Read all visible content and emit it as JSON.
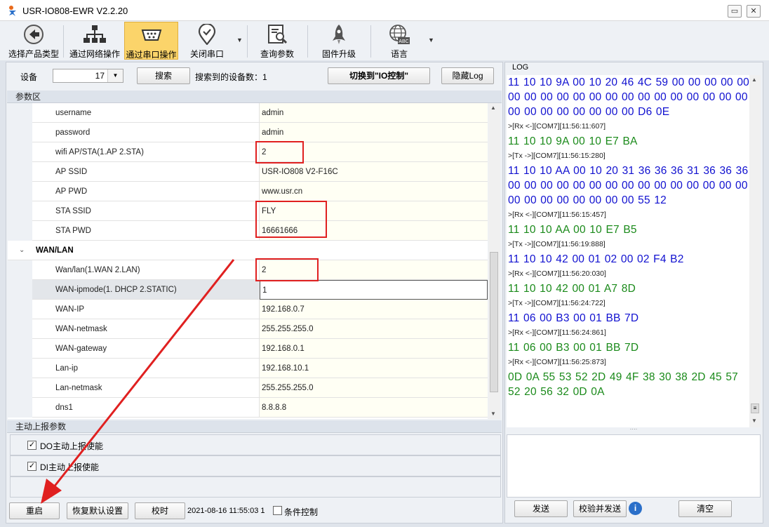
{
  "window": {
    "title": "USR-IO808-EWR V2.2.20",
    "minimize": "▭",
    "close": "✕"
  },
  "toolbar": {
    "items": [
      {
        "label": "选择产品类型",
        "icon": "back-arrow-icon"
      },
      {
        "label": "通过网络操作",
        "icon": "network-icon"
      },
      {
        "label": "通过串口操作",
        "icon": "serial-port-icon"
      },
      {
        "label": "关闭串口",
        "icon": "map-pin-icon"
      },
      {
        "label": "查询参数",
        "icon": "search-document-icon"
      },
      {
        "label": "固件升级",
        "icon": "rocket-icon"
      },
      {
        "label": "语言",
        "icon": "globe-abc-icon"
      }
    ],
    "dropdown_glyph": "▼"
  },
  "device_bar": {
    "device_label": "设备",
    "device_value": "17",
    "search_button": "搜索",
    "found_text": "搜索到的设备数：1",
    "switch_button": "切换到\"IO控制\"",
    "hide_log_button": "隐藏Log"
  },
  "params": {
    "header": "参数区",
    "rows": [
      {
        "name": "username",
        "value": "admin"
      },
      {
        "name": "password",
        "value": "admin"
      },
      {
        "name": "wifi AP/STA(1.AP 2.STA)",
        "value": "2"
      },
      {
        "name": "AP SSID",
        "value": "USR-IO808 V2-F16C"
      },
      {
        "name": "AP PWD",
        "value": "www.usr.cn"
      },
      {
        "name": "STA SSID",
        "value": "FLY"
      },
      {
        "name": "STA PWD",
        "value": "16661666"
      }
    ],
    "category": "WAN/LAN",
    "category_rows": [
      {
        "name": "Wan/lan(1.WAN 2.LAN)",
        "value": "2"
      },
      {
        "name": "WAN-ipmode(1. DHCP 2.STATIC)",
        "value": "1"
      },
      {
        "name": "WAN-IP",
        "value": "192.168.0.7"
      },
      {
        "name": "WAN-netmask",
        "value": "255.255.255.0"
      },
      {
        "name": "WAN-gateway",
        "value": "192.168.0.1"
      },
      {
        "name": "Lan-ip",
        "value": "192.168.10.1"
      },
      {
        "name": "Lan-netmask",
        "value": "255.255.255.0"
      },
      {
        "name": "dns1",
        "value": "8.8.8.8"
      }
    ]
  },
  "auto_report": {
    "header": "主动上报参数",
    "options": [
      {
        "label": "DO主动上报使能",
        "checked": true
      },
      {
        "label": "DI主动上报使能",
        "checked": true
      }
    ]
  },
  "bottom_bar": {
    "restart_button": "重启",
    "restore_button": "恢复默认设置",
    "time_button": "校时",
    "timestamp": "2021-08-16 11:55:03 1",
    "condition_label": "条件控制"
  },
  "log": {
    "header": "LOG",
    "lines": [
      {
        "kind": "rx",
        "text": "11 10 10 9A 00 10 20 46 4C 59 00 00 00 00 00 00 00 00 00 00 00 00 00 00 00 00 00 00 00 00 00 00 00 00 00 00 00 00 D6 0E"
      },
      {
        "kind": "meta",
        "text": ">[Rx <-][COM7][11:56:11:607]"
      },
      {
        "kind": "tx",
        "text": "11 10 10 9A 00 10 E7 BA"
      },
      {
        "kind": "meta",
        "text": ">[Tx ->][COM7][11:56:15:280]"
      },
      {
        "kind": "rx",
        "text": "11 10 10 AA 00 10 20 31 36 36 36 31 36 36 36 00 00 00 00 00 00 00 00 00 00 00 00 00 00 00 00 00 00 00 00 00 00 00 55 12"
      },
      {
        "kind": "meta",
        "text": ">[Rx <-][COM7][11:56:15:457]"
      },
      {
        "kind": "tx",
        "text": "11 10 10 AA 00 10 E7 B5"
      },
      {
        "kind": "meta",
        "text": ">[Tx ->][COM7][11:56:19:888]"
      },
      {
        "kind": "rx",
        "text": "11 10 10 42 00 01 02 00 02 F4 B2"
      },
      {
        "kind": "meta",
        "text": ">[Rx <-][COM7][11:56:20:030]"
      },
      {
        "kind": "tx",
        "text": "11 10 10 42 00 01 A7 8D"
      },
      {
        "kind": "meta",
        "text": ">[Tx ->][COM7][11:56:24:722]"
      },
      {
        "kind": "rx",
        "text": "11 06 00 B3 00 01 BB 7D"
      },
      {
        "kind": "meta",
        "text": ">[Rx <-][COM7][11:56:24:861]"
      },
      {
        "kind": "tx",
        "text": "11 06 00 B3 00 01 BB 7D"
      },
      {
        "kind": "meta",
        "text": ">[Rx <-][COM7][11:56:25:873]"
      },
      {
        "kind": "tx",
        "text": "0D 0A 55 53 52 2D 49 4F 38 30 38 2D 45 57 52 20 56 32 0D 0A"
      }
    ],
    "send_button": "发送",
    "checksum_send_button": "校验并发送",
    "info_glyph": "i",
    "clear_button": "清空"
  },
  "annotation_color": "#e02020"
}
